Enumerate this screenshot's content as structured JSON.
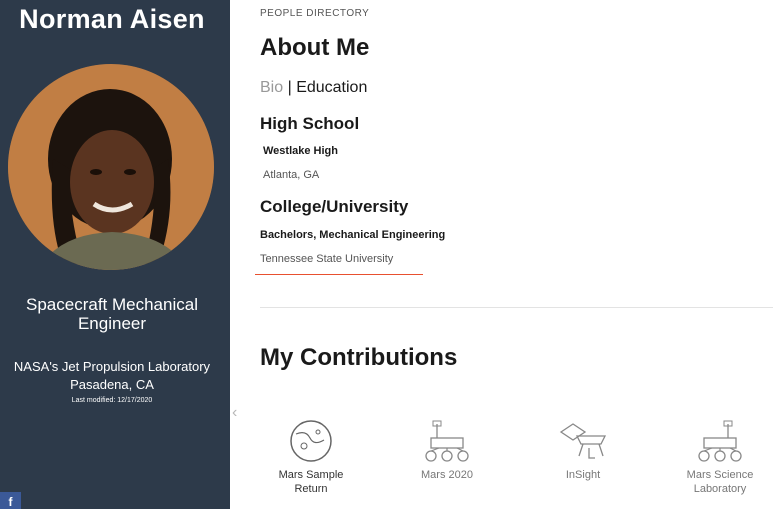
{
  "profile": {
    "name": "Norman Aisen",
    "title": "Spacecraft Mechanical Engineer",
    "org": "NASA's Jet Propulsion Laboratory",
    "location": "Pasadena, CA",
    "modified": "Last modified: 12/17/2020"
  },
  "social": {
    "facebook_label": "f"
  },
  "page": {
    "eyebrow": "PEOPLE DIRECTORY",
    "heading": "About Me"
  },
  "tabs": {
    "bio": "Bio",
    "separator": "|",
    "education": "Education"
  },
  "education": {
    "high_school_heading": "High School",
    "high_school_name": "Westlake High",
    "high_school_location": "Atlanta, GA",
    "college_heading": "College/University",
    "degree": "Bachelors, Mechanical Engineering",
    "university": "Tennessee State University"
  },
  "contributions": {
    "heading": "My Contributions",
    "items": [
      {
        "label": "Mars Sample Return",
        "icon": "planet-icon"
      },
      {
        "label": "Mars 2020",
        "icon": "rover-icon"
      },
      {
        "label": "InSight",
        "icon": "lander-icon"
      },
      {
        "label": "Mars Science Laboratory",
        "icon": "rover-icon"
      }
    ]
  },
  "colors": {
    "sidebar": "#2d3a4a",
    "accent": "#e8502f",
    "facebook": "#3b5998"
  }
}
